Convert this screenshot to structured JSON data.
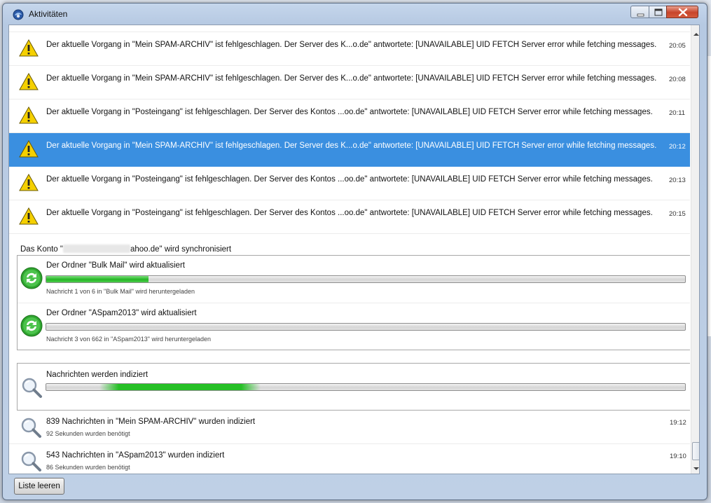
{
  "window": {
    "title": "Aktivitäten"
  },
  "errors": [
    {
      "message": "Der aktuelle Vorgang in \"Mein SPAM-ARCHIV\" ist fehlgeschlagen. Der Server des K...o.de\" antwortete: [UNAVAILABLE] UID FETCH Server error while fetching messages.",
      "time": "20:05",
      "selected": false
    },
    {
      "message": "Der aktuelle Vorgang in \"Mein SPAM-ARCHIV\" ist fehlgeschlagen. Der Server des K...o.de\" antwortete: [UNAVAILABLE] UID FETCH Server error while fetching messages.",
      "time": "20:08",
      "selected": false
    },
    {
      "message": "Der aktuelle Vorgang in \"Posteingang\" ist fehlgeschlagen. Der Server des Kontos ...oo.de\" antwortete: [UNAVAILABLE] UID FETCH Server error while fetching messages.",
      "time": "20:11",
      "selected": false
    },
    {
      "message": "Der aktuelle Vorgang in \"Mein SPAM-ARCHIV\" ist fehlgeschlagen. Der Server des K...o.de\" antwortete: [UNAVAILABLE] UID FETCH Server error while fetching messages.",
      "time": "20:12",
      "selected": true
    },
    {
      "message": "Der aktuelle Vorgang in \"Posteingang\" ist fehlgeschlagen. Der Server des Kontos ...oo.de\" antwortete: [UNAVAILABLE] UID FETCH Server error while fetching messages.",
      "time": "20:13",
      "selected": false
    },
    {
      "message": "Der aktuelle Vorgang in \"Posteingang\" ist fehlgeschlagen. Der Server des Kontos ...oo.de\" antwortete: [UNAVAILABLE] UID FETCH Server error while fetching messages.",
      "time": "20:15",
      "selected": false
    }
  ],
  "sync_group": {
    "label_prefix": "Das Konto \"",
    "label_suffix": "ahoo.de\" wird synchronisiert",
    "items": [
      {
        "label": "Der Ordner \"Bulk Mail\" wird aktualisiert",
        "detail": "Nachricht 1 von 6 in \"Bulk Mail\" wird heruntergeladen",
        "progress": 0.16
      },
      {
        "label": "Der Ordner \"ASpam2013\" wird aktualisiert",
        "detail": "Nachricht 3 von 662 in \"ASpam2013\" wird heruntergeladen",
        "progress": 0.0
      }
    ]
  },
  "indexing": {
    "label": "Nachrichten werden indiziert"
  },
  "completed": [
    {
      "label": "839 Nachrichten in \"Mein SPAM-ARCHIV\" wurden indiziert",
      "detail": "92 Sekunden wurden benötigt",
      "time": "19:12"
    },
    {
      "label": "543 Nachrichten in \"ASpam2013\" wurden indiziert",
      "detail": "86 Sekunden wurden benötigt",
      "time": "19:10"
    }
  ],
  "footer": {
    "clear_button": "Liste leeren"
  },
  "colors": {
    "selection": "#3a8fe0",
    "progress": "#25b525",
    "warning": "#f5d000"
  }
}
